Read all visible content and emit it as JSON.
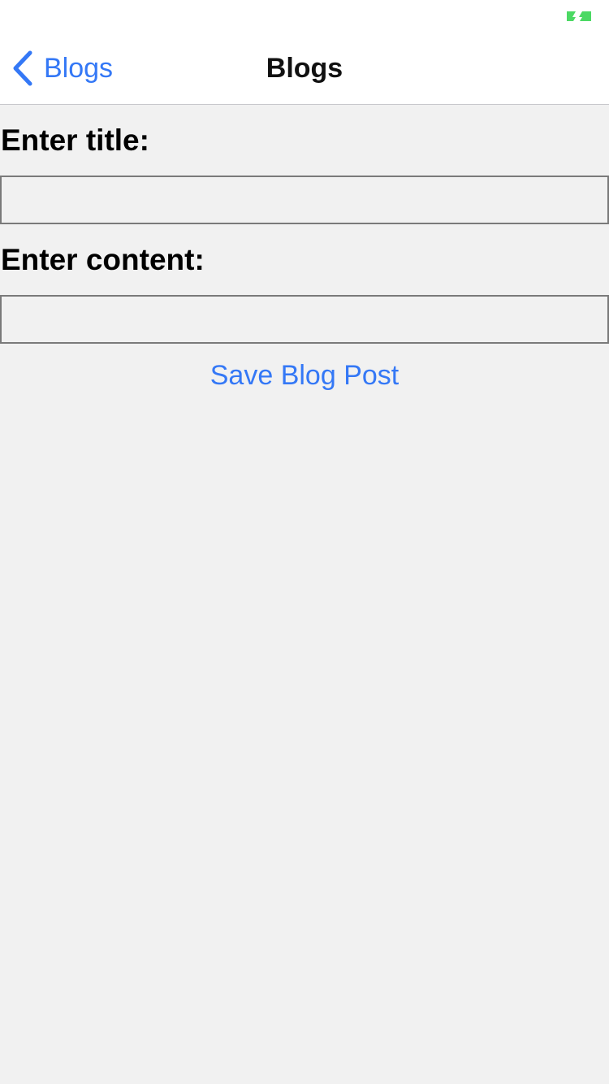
{
  "colors": {
    "accent": "#3478f6",
    "battery": "#4cd964",
    "background": "#f1f1f1",
    "nav_background": "#ffffff"
  },
  "status_bar": {
    "battery_icon": "battery-charging-icon"
  },
  "nav": {
    "back_icon": "chevron-left-icon",
    "back_label": "Blogs",
    "title": "Blogs"
  },
  "form": {
    "title_label": "Enter title:",
    "title_value": "",
    "content_label": "Enter content:",
    "content_value": "",
    "save_label": "Save Blog Post"
  }
}
